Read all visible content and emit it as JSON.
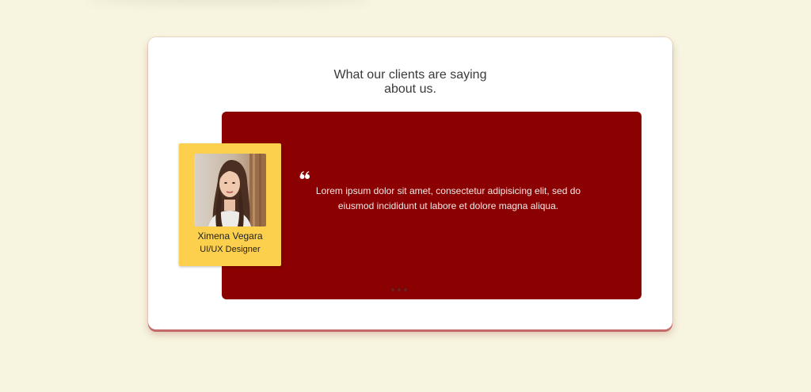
{
  "testimonial": {
    "heading_line1": "What our clients are saying",
    "heading_line2": "about us.",
    "quote_icon": "quote-left-icon",
    "quote": "Lorem ipsum dolor sit amet, consectetur adipisicing elit, sed do eiusmod incididunt ut labore et dolore magna aliqua.",
    "person": {
      "name": "Ximena Vegara",
      "role": "UI/UX Designer"
    },
    "carousel": {
      "dot_count": 3,
      "active_index": 0
    }
  },
  "colors": {
    "page_background": "#f7f5df",
    "card_background": "#ffffff",
    "panel_background": "#8b0000",
    "profile_background": "#fcd04d",
    "card_shadow": "#c56a6a"
  }
}
